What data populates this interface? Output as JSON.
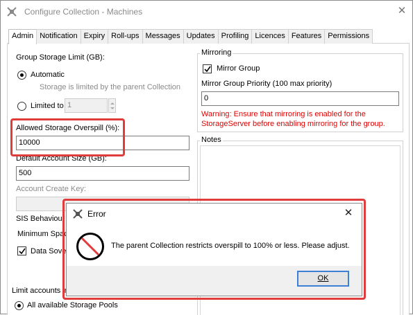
{
  "window": {
    "title": "Configure Collection - Machines",
    "close_glyph": "✕"
  },
  "tabs": [
    "Admin",
    "Notification",
    "Expiry",
    "Roll-ups",
    "Messages",
    "Updates",
    "Profiling",
    "Licences",
    "Features",
    "Permissions"
  ],
  "admin": {
    "group_storage_limit_label": "Group Storage Limit (GB):",
    "automatic_label": "Automatic",
    "automatic_checked": true,
    "automatic_hint": "Storage is limited by the parent Collection",
    "limited_to_label": "Limited to",
    "limited_to_value": "1",
    "allowed_overspill_label": "Allowed Storage Overspill (%):",
    "allowed_overspill_value": "10000",
    "default_account_size_label": "Default Account Size (GB):",
    "default_account_size_value": "500",
    "account_create_key_label": "Account Create Key:",
    "account_create_key_value": "",
    "sis_behaviour_label": "SIS Behaviour",
    "minimum_space_label": "Minimum Space",
    "data_sovereignty_label": "Data Sover",
    "data_sovereignty_checked": true,
    "limit_accounts_label": "Limit accounts in",
    "all_pools_label": "All available Storage Pools",
    "all_pools_checked": true
  },
  "mirroring": {
    "group_title": "Mirroring",
    "mirror_group_label": "Mirror Group",
    "mirror_group_checked": true,
    "priority_label": "Mirror Group Priority (100 max priority)",
    "priority_value": "0",
    "warning_line1": "Warning: Ensure that mirroring is enabled for the",
    "warning_line2": "StorageServer before enabling mirroring for the group."
  },
  "notes": {
    "group_title": "Notes"
  },
  "error_dialog": {
    "title": "Error",
    "message": "The parent Collection restricts overspill to 100% or less. Please adjust.",
    "ok_label": "OK",
    "close_glyph": "✕"
  },
  "colors": {
    "highlight": "#e03c3c",
    "warning_text": "#e00000",
    "focus_border": "#3c7fd6"
  }
}
